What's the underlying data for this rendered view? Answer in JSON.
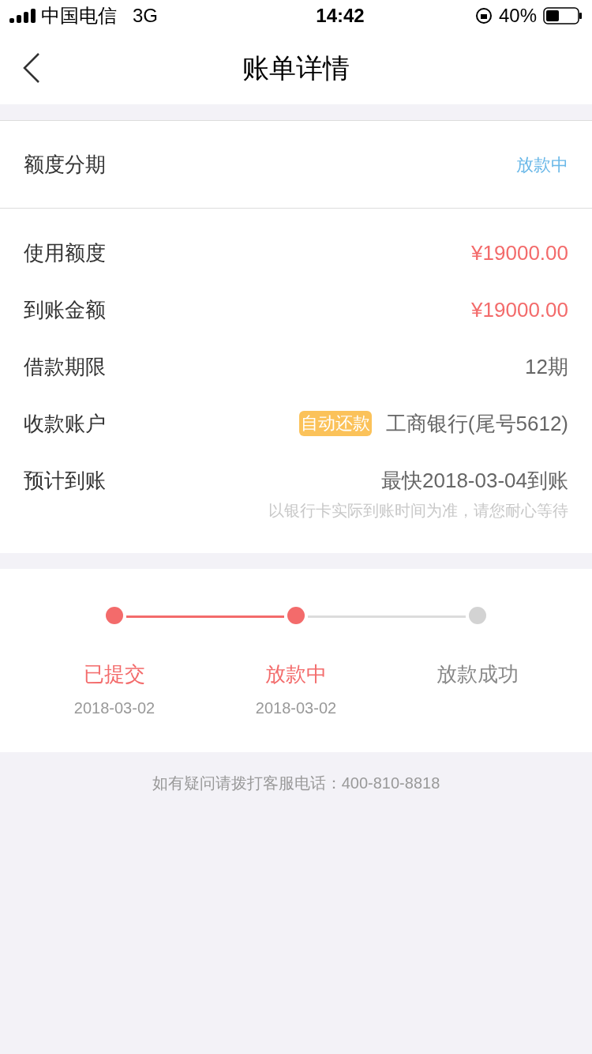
{
  "status_bar": {
    "carrier": "中国电信",
    "network": "3G",
    "time": "14:42",
    "battery": "40%"
  },
  "nav": {
    "title": "账单详情"
  },
  "header": {
    "label": "额度分期",
    "status": "放款中"
  },
  "details": [
    {
      "kind": "amount",
      "label": "使用额度",
      "value": "¥19000.00"
    },
    {
      "kind": "amount",
      "label": "到账金额",
      "value": "¥19000.00"
    },
    {
      "kind": "plain",
      "label": "借款期限",
      "value": "12期"
    },
    {
      "kind": "account",
      "label": "收款账户",
      "badge": "自动还款",
      "value": "工商银行(尾号5612)"
    },
    {
      "kind": "eta",
      "label": "预计到账",
      "value": "最快2018-03-04到账",
      "note": "以银行卡实际到账时间为准，请您耐心等待"
    }
  ],
  "steps": [
    {
      "label": "已提交",
      "date": "2018-03-02",
      "done": true
    },
    {
      "label": "放款中",
      "date": "2018-03-02",
      "done": true
    },
    {
      "label": "放款成功",
      "done": false
    }
  ],
  "footer": "如有疑问请拨打客服电话：400-810-8818"
}
